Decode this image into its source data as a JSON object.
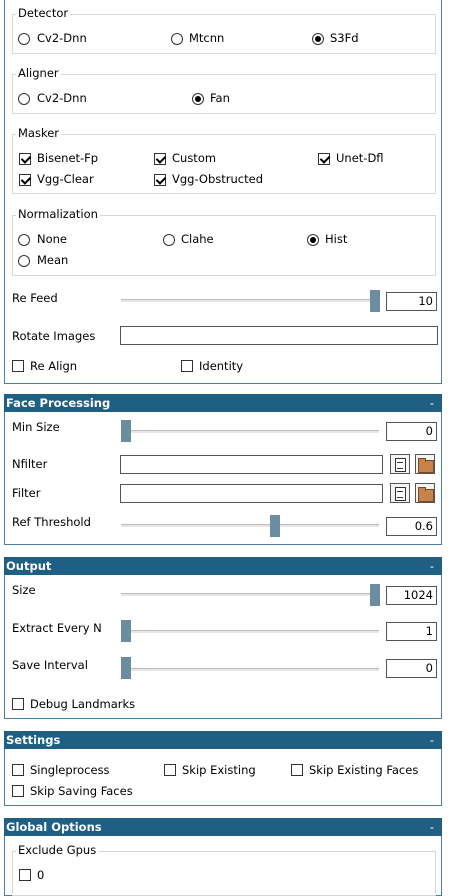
{
  "top_panel": {
    "detector": {
      "title": "Detector",
      "options": [
        "Cv2-Dnn",
        "Mtcnn",
        "S3Fd"
      ],
      "selected": "S3Fd"
    },
    "aligner": {
      "title": "Aligner",
      "options": [
        "Cv2-Dnn",
        "Fan"
      ],
      "selected": "Fan"
    },
    "masker": {
      "title": "Masker",
      "items": [
        {
          "label": "Bisenet-Fp",
          "checked": true
        },
        {
          "label": "Custom",
          "checked": true
        },
        {
          "label": "Unet-Dfl",
          "checked": true
        },
        {
          "label": "Vgg-Clear",
          "checked": true
        },
        {
          "label": "Vgg-Obstructed",
          "checked": true
        }
      ]
    },
    "normalization": {
      "title": "Normalization",
      "options": [
        "None",
        "Clahe",
        "Hist",
        "Mean"
      ],
      "selected": "Hist"
    },
    "re_feed": {
      "label": "Re Feed",
      "value": "10",
      "fraction": 1.0
    },
    "rotate_images": {
      "label": "Rotate Images",
      "value": ""
    },
    "re_align": {
      "label": "Re Align",
      "checked": false
    },
    "identity": {
      "label": "Identity",
      "checked": false
    }
  },
  "face_processing": {
    "title": "Face Processing",
    "collapse": "-",
    "min_size": {
      "label": "Min Size",
      "value": "0",
      "fraction": 0.0
    },
    "nfilter": {
      "label": "Nfilter",
      "value": ""
    },
    "filter": {
      "label": "Filter",
      "value": ""
    },
    "ref_threshold": {
      "label": "Ref Threshold",
      "value": "0.6",
      "fraction": 0.6
    }
  },
  "output": {
    "title": "Output",
    "collapse": "-",
    "size": {
      "label": "Size",
      "value": "1024",
      "fraction": 1.0
    },
    "extract_every_n": {
      "label": "Extract Every N",
      "value": "1",
      "fraction": 0.0
    },
    "save_interval": {
      "label": "Save Interval",
      "value": "0",
      "fraction": 0.0
    },
    "debug_landmarks": {
      "label": "Debug Landmarks",
      "checked": false
    }
  },
  "settings": {
    "title": "Settings",
    "collapse": "-",
    "items": [
      {
        "label": "Singleprocess",
        "checked": false
      },
      {
        "label": "Skip Existing",
        "checked": false
      },
      {
        "label": "Skip Existing Faces",
        "checked": false
      },
      {
        "label": "Skip Saving Faces",
        "checked": false
      }
    ]
  },
  "global_options": {
    "title": "Global Options",
    "collapse": "-",
    "exclude_gpus": {
      "title": "Exclude Gpus",
      "items": [
        {
          "label": "0",
          "checked": false
        }
      ]
    }
  },
  "icons": {
    "file": "file-list-icon",
    "folder": "folder-icon"
  }
}
